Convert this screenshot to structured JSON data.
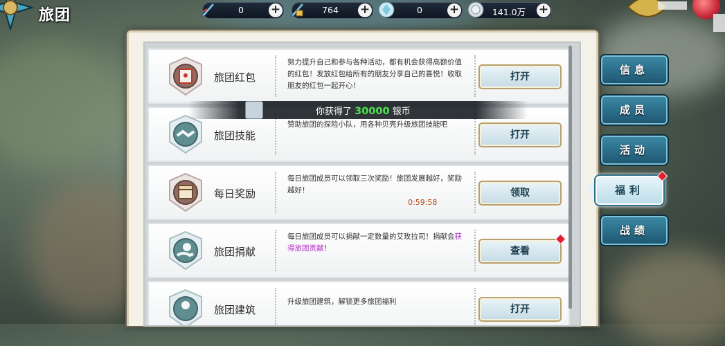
{
  "header": {
    "title": "旅团"
  },
  "currencies": [
    {
      "name": "currency-1",
      "value": "0"
    },
    {
      "name": "currency-2",
      "value": "764"
    },
    {
      "name": "currency-3",
      "value": "0"
    },
    {
      "name": "silver",
      "value": "141.0万"
    }
  ],
  "plus_label": "+",
  "rows": [
    {
      "title": "旅团红包",
      "desc": "努力提升自己和参与各种活动，都有机会获得高额价值的红包！发放红包给所有的朋友分享自己的喜悦！收取朋友的红包一起开心！",
      "button": "打开",
      "icon": "red-envelope-icon"
    },
    {
      "title": "旅团技能",
      "desc": "赞助旅团的探险小队，用各种贝壳升级旅团技能吧",
      "button": "打开",
      "icon": "handshake-icon"
    },
    {
      "title": "每日奖励",
      "desc": "每日旅团成员可以领取三次奖励！旅团发展越好，奖励越好！",
      "timer": "0:59:58",
      "button": "领取",
      "icon": "treasure-chest-icon"
    },
    {
      "title": "旅团捐献",
      "desc_prefix": "每日旅团成员可以捐献一定数量的艾玫拉司！捐献会",
      "desc_highlight": "获得旅团贡献",
      "desc_suffix": "！",
      "button": "查看",
      "icon": "donation-icon"
    },
    {
      "title": "旅团建筑",
      "desc": "升级旅团建筑，解锁更多旅团福利",
      "button": "打开",
      "icon": "building-icon"
    }
  ],
  "toast": {
    "prefix": "你获得了",
    "amount": "30000",
    "suffix": "银币"
  },
  "tabs": [
    {
      "label": "信息"
    },
    {
      "label": "成员"
    },
    {
      "label": "活动"
    },
    {
      "label": "福利"
    },
    {
      "label": "战绩"
    }
  ],
  "colors": {
    "toast_amount": "#4de34f",
    "highlight": "#b52bc8",
    "timer": "#b34712",
    "notify": "#e0202e"
  }
}
